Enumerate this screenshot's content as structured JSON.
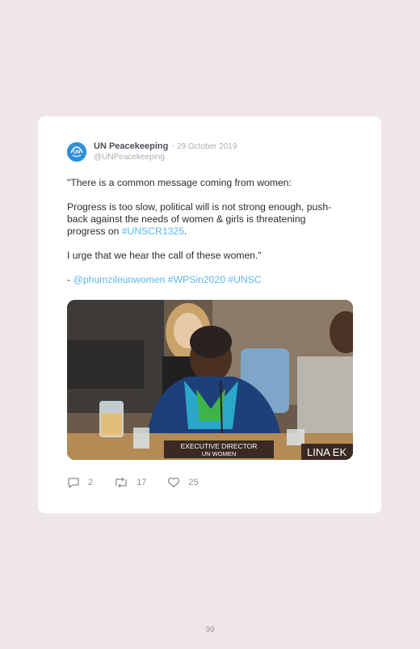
{
  "tweet": {
    "author_name": "UN Peacekeeping",
    "date": "- 29 October 2019",
    "handle": "@UNPeacekeeping",
    "avatar_text": "UN",
    "paragraphs": {
      "p1": "\"There is a common message coming from women:",
      "p2_text": "Progress is too slow, political will is not strong enough, push-back against the needs of women & girls is threatening progress on ",
      "p2_link": "#UNSCR1325",
      "p2_end": ".",
      "p3": "I urge that we hear the call of these women.\"",
      "p4_prefix": "- ",
      "p4_mention": "@phumzileunwomen",
      "p4_tag1": "#WPSin2020",
      "p4_tag2": "#UNSC"
    },
    "image": {
      "nameplate_line1": "EXECUTIVE DIRECTOR",
      "nameplate_line2": "UN WOMEN",
      "nameplate_right": "LINA EK"
    },
    "actions": {
      "replies": "2",
      "retweets": "17",
      "likes": "25"
    }
  },
  "page": {
    "number": "99"
  }
}
